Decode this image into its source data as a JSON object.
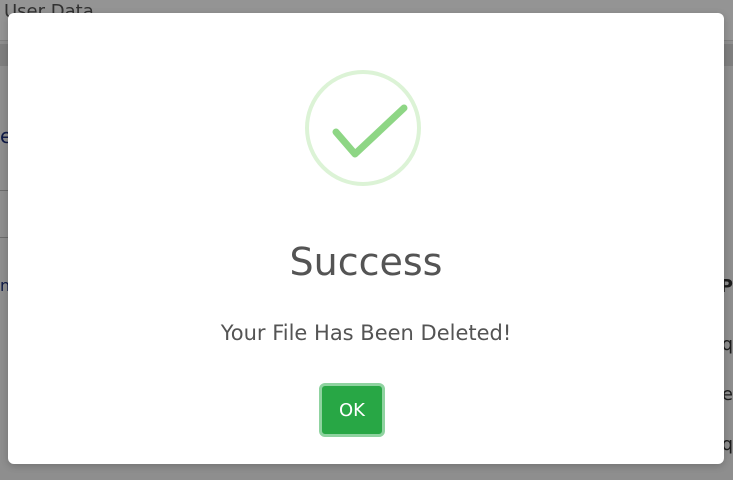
{
  "background": {
    "header_title": "User Data",
    "left_glyph": "e",
    "left_glyph_2": "n",
    "right_glyphs": [
      "P",
      "q",
      "e",
      "q"
    ]
  },
  "modal": {
    "icon": "checkmark-icon",
    "title": "Success",
    "message": "Your File Has Been Deleted!",
    "confirm_label": "OK"
  },
  "colors": {
    "success_green": "#28a745",
    "check_green": "#8ed685",
    "ring": "#dcf3d6",
    "text": "#545454"
  }
}
